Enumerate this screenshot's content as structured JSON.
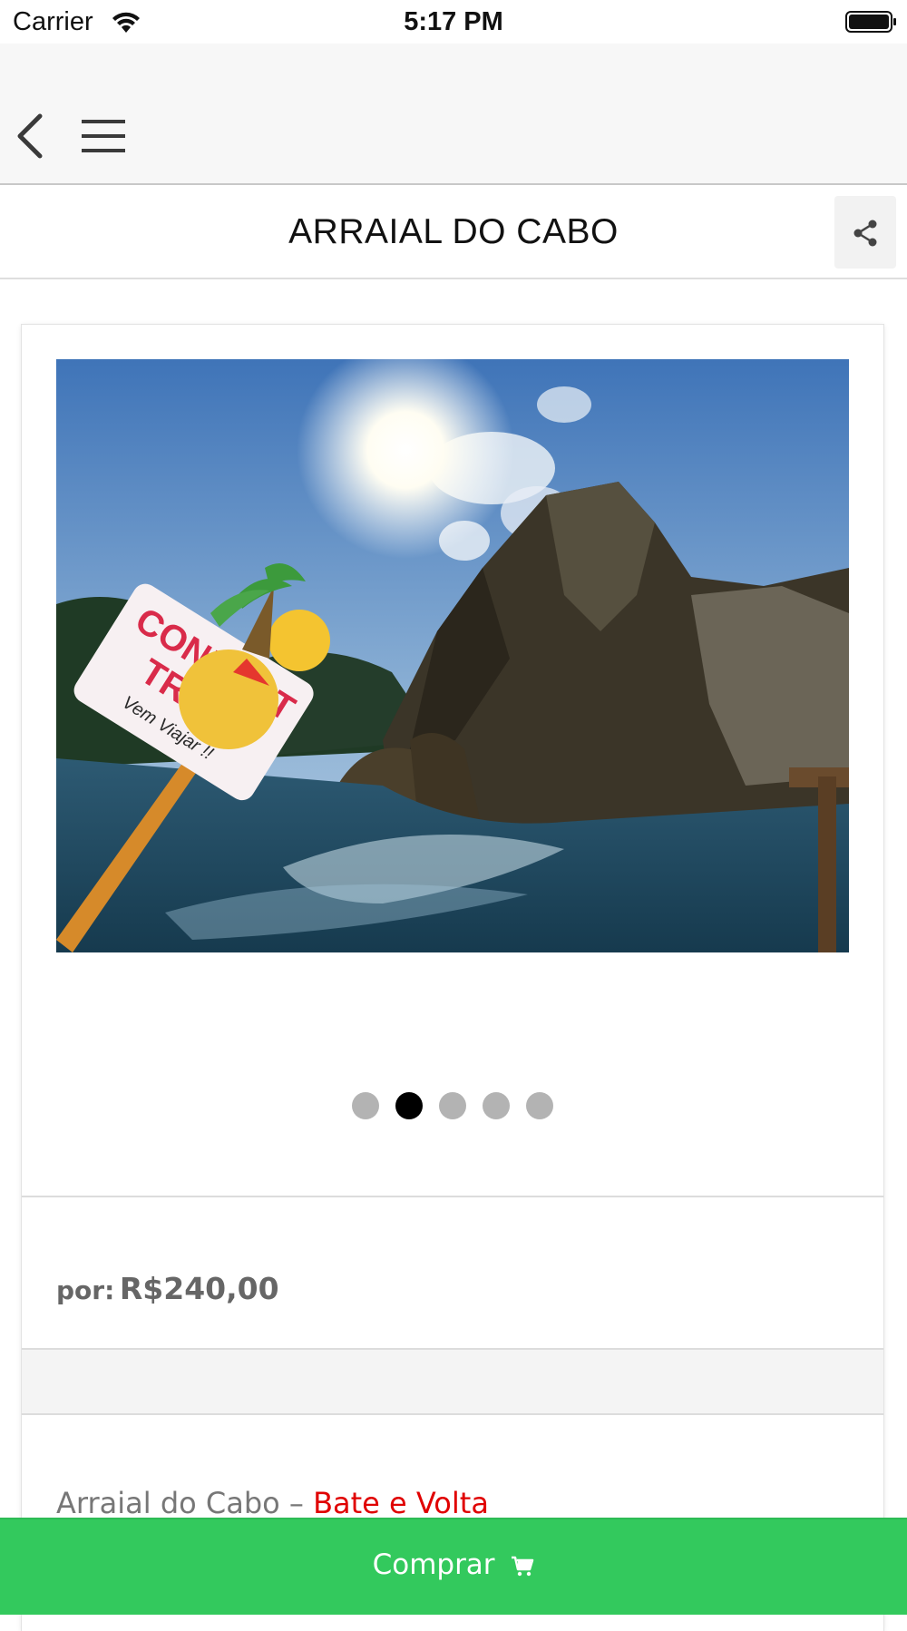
{
  "status_bar": {
    "carrier": "Carrier",
    "time": "5:17 PM"
  },
  "nav": {
    "back_icon": "chevron-left",
    "menu_icon": "hamburger"
  },
  "title_bar": {
    "title": "ARRAIAL DO CABO",
    "share_icon": "share"
  },
  "gallery": {
    "image_description": "coastal cliff with Connect Trips sign",
    "logo_text": [
      "CONNECT",
      "TRIPS",
      "Vem Viajar !!"
    ],
    "dot_count": 5,
    "active_index": 1
  },
  "price": {
    "label": "por:",
    "value": "R$240,00"
  },
  "description": {
    "prefix": "Arraial do Cabo – ",
    "highlight": "Bate e Volta"
  },
  "buy_button": {
    "label": "Comprar",
    "icon": "cart"
  },
  "colors": {
    "buy_green": "#33c95d",
    "highlight_red": "#e00000",
    "nav_bg": "#f7f7f7"
  }
}
